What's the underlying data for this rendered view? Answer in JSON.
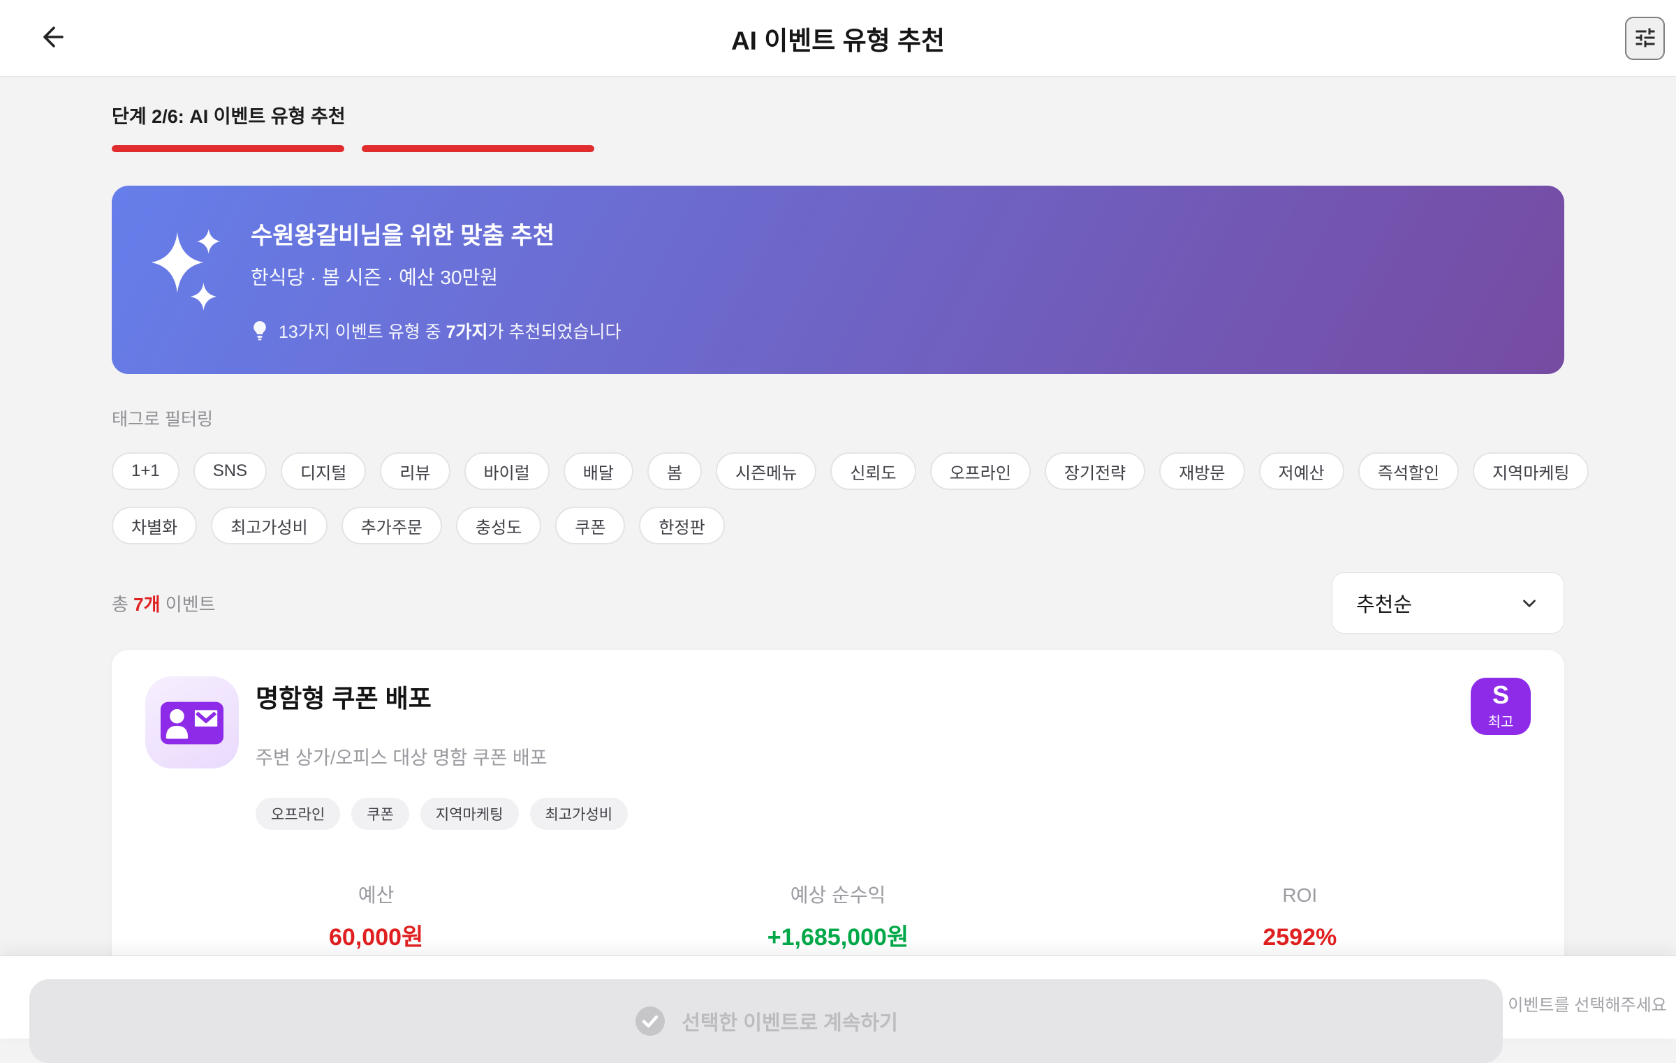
{
  "header": {
    "title": "AI 이벤트 유형 추천"
  },
  "progress": {
    "label": "단계 2/6: AI 이벤트 유형 추천",
    "filled_segments": 2,
    "color": "#e02c2c"
  },
  "banner": {
    "title": "수원왕갈비님을 위한 맞춤 추천",
    "subtitle": "한식당 · 봄 시즌 · 예산 30만원",
    "info_prefix": "13가지 이벤트 유형 중 ",
    "info_bold": "7가지",
    "info_suffix": "가 추천되었습니다",
    "gradient_start": "#667eea",
    "gradient_end": "#764ba2"
  },
  "filter": {
    "label": "태그로 필터링",
    "tags_row1": [
      "1+1",
      "SNS",
      "디지털",
      "리뷰",
      "바이럴",
      "배달",
      "봄",
      "시즌메뉴",
      "신뢰도",
      "오프라인",
      "장기전략",
      "재방문",
      "저예산",
      "즉석할인",
      "지역마케팅"
    ],
    "tags_row2": [
      "차별화",
      "최고가성비",
      "추가주문",
      "충성도",
      "쿠폰",
      "한정판"
    ]
  },
  "list_header": {
    "count_prefix": "총 ",
    "count": "7개",
    "count_suffix": " 이벤트",
    "count_color": "#e02020",
    "sort_selected": "추천순"
  },
  "event_card": {
    "title": "명함형 쿠폰 배포",
    "description": "주변 상가/오피스 대상 명함 쿠폰 배포",
    "tags": [
      "오프라인",
      "쿠폰",
      "지역마케팅",
      "최고가성비"
    ],
    "grade": {
      "letter": "S",
      "label": "최고",
      "color": "#8d2be8"
    },
    "icon_color": "#8d2be8",
    "stats": [
      {
        "label": "예산",
        "value": "60,000원",
        "color": "#e02020"
      },
      {
        "label": "예상 순수익",
        "value": "+1,685,000원",
        "color": "#00a848"
      },
      {
        "label": "ROI",
        "value": "2592%",
        "color": "#e02020"
      }
    ]
  },
  "bottom_bar": {
    "button_label": "선택한 이벤트로 계속하기",
    "helper_text": "이벤트를 선택해주세요"
  }
}
